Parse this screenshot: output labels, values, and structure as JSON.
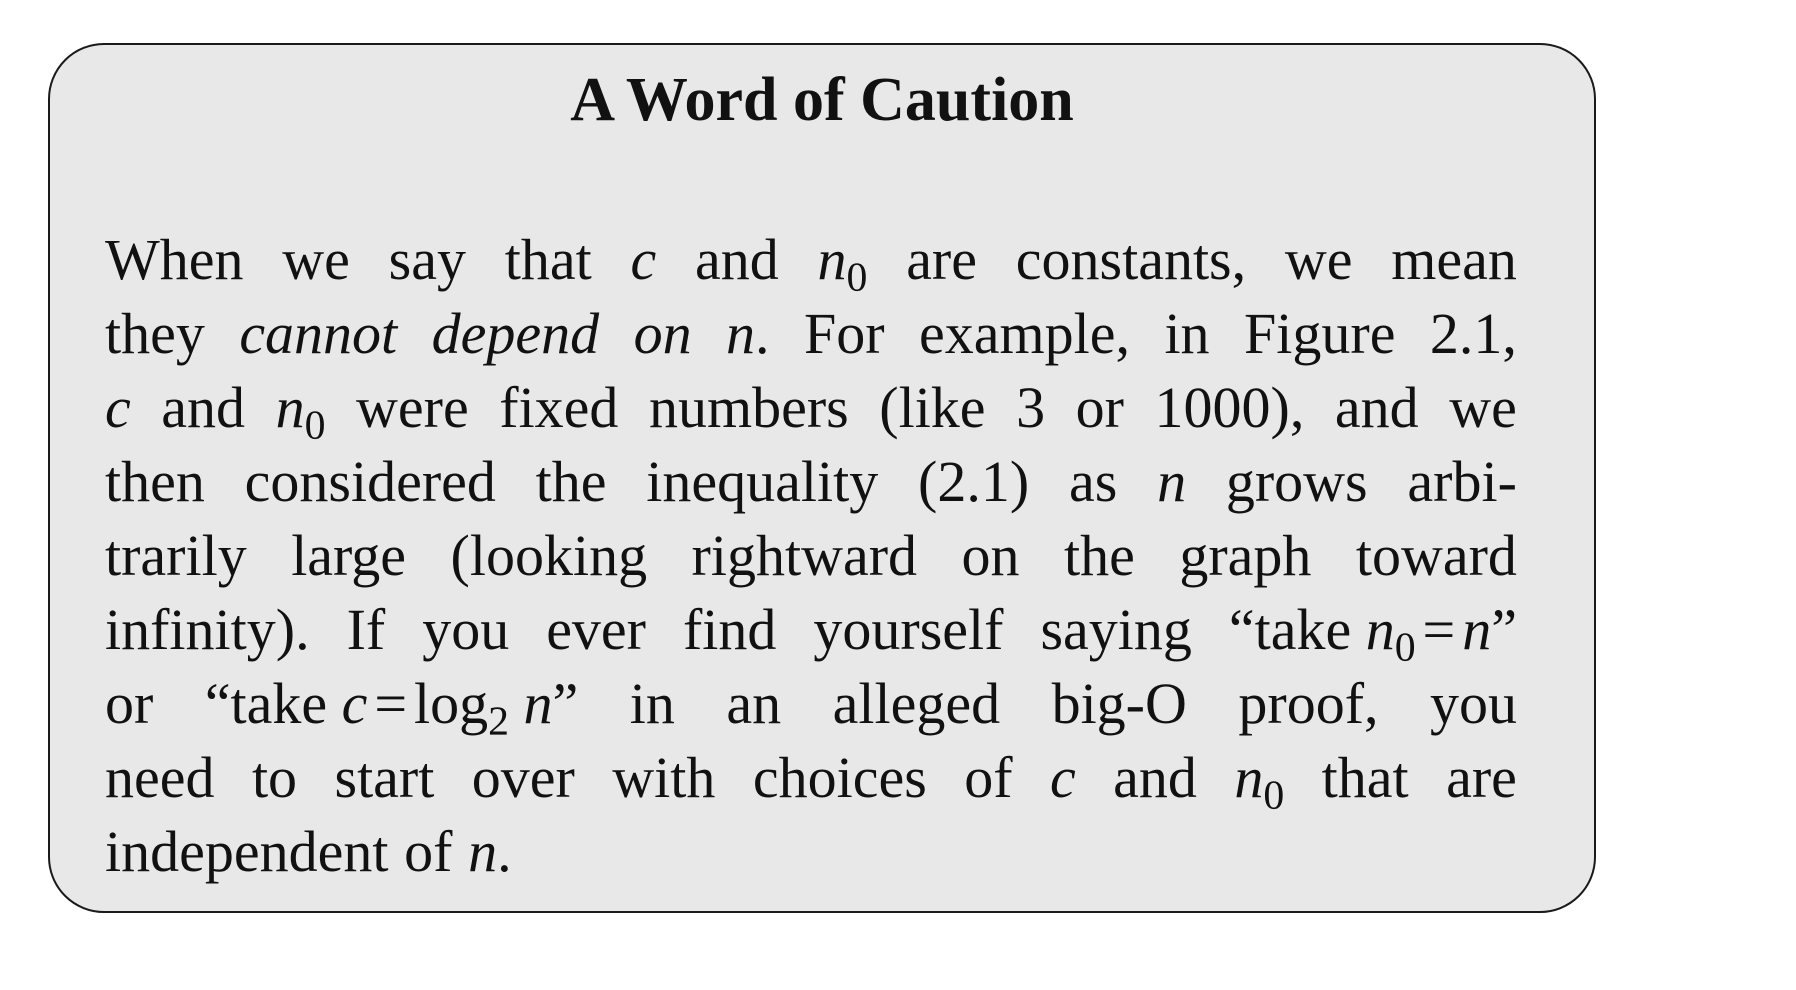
{
  "box": {
    "title": "A Word of Caution",
    "words": {
      "when": "When",
      "we": "we",
      "say": "say",
      "that": "that",
      "and": "and",
      "are": "are",
      "constants_comma": "constants,",
      "mean": "mean",
      "they": "they",
      "cannot": "cannot",
      "depend": "depend",
      "on": "on",
      "for": "For",
      "example": "example,",
      "in": "in",
      "figure": "Figure",
      "fig_num": "2.1,",
      "were": "were",
      "fixed": "fixed",
      "numbers": "numbers",
      "like": "(like",
      "three": "3",
      "or": "or",
      "thousand": "1000),",
      "then": "then",
      "considered": "considered",
      "the": "the",
      "inequality": "inequality",
      "eq_ref": "(2.1)",
      "as": "as",
      "grows": "grows",
      "arbi": "arbi-",
      "trarily": "trarily",
      "large": "large",
      "looking": "(looking",
      "rightward": "rightward",
      "graph": "graph",
      "toward": "toward",
      "infinity": "infinity).",
      "if": "If",
      "you": "you",
      "ever": "ever",
      "find": "find",
      "yourself": "yourself",
      "saying": "saying",
      "take_open": "“take",
      "close_quote": "”",
      "an": "an",
      "alleged": "alleged",
      "bigo": "big-O",
      "proof": "proof,",
      "need": "need",
      "to": "to",
      "start": "start",
      "over": "over",
      "with": "with",
      "choices": "choices",
      "of": "of",
      "independent": "independent",
      "log": "log"
    },
    "math": {
      "c": "c",
      "n": "n",
      "n_sub": "0",
      "log_base": "2",
      "equals": "=",
      "period": ".",
      "period_end": "."
    }
  }
}
